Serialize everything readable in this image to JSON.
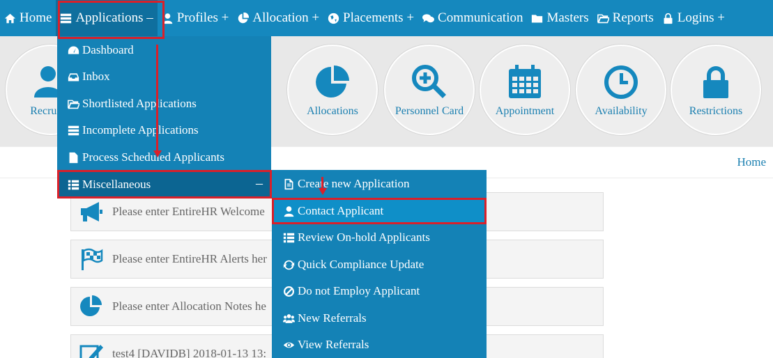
{
  "nav": {
    "items": [
      {
        "label": "Home",
        "icon": "home-icon"
      },
      {
        "label": "Applications –",
        "icon": "list-icon"
      },
      {
        "label": "Profiles +",
        "icon": "user-icon"
      },
      {
        "label": "Allocation +",
        "icon": "pie-chart-icon"
      },
      {
        "label": "Placements +",
        "icon": "globe-icon"
      },
      {
        "label": "Communication",
        "icon": "chat-icon"
      },
      {
        "label": "Masters",
        "icon": "folder-icon"
      },
      {
        "label": "Reports",
        "icon": "folder-open-icon"
      },
      {
        "label": "Logins +",
        "icon": "lock-icon"
      }
    ]
  },
  "tiles": [
    {
      "label": "Recruitm",
      "icon": "user-add-icon"
    },
    {
      "label": "Allocations",
      "icon": "pie-chart-icon"
    },
    {
      "label": "Personnel Card",
      "icon": "search-plus-icon"
    },
    {
      "label": "Appointment",
      "icon": "calendar-icon"
    },
    {
      "label": "Availability",
      "icon": "clock-icon"
    },
    {
      "label": "Restrictions",
      "icon": "lock-icon"
    }
  ],
  "breadcrumb": {
    "home": "Home"
  },
  "notices": [
    {
      "text": "Please enter EntireHR Welcome",
      "icon": "megaphone-icon"
    },
    {
      "text": "Please enter EntireHR Alerts her",
      "icon": "flag-icon"
    },
    {
      "text": "Please enter Allocation Notes he",
      "icon": "pie-chart-icon"
    },
    {
      "text": "test4 [DAVIDB] 2018-01-13 13:",
      "icon": "edit-icon"
    }
  ],
  "applications_menu": {
    "items": [
      {
        "label": "Dashboard",
        "icon": "dashboard-icon"
      },
      {
        "label": "Inbox",
        "icon": "inbox-icon"
      },
      {
        "label": "Shortlisted Applications",
        "icon": "folder-open-icon"
      },
      {
        "label": "Incomplete Applications",
        "icon": "list-icon"
      },
      {
        "label": "Process Scheduled Applicants",
        "icon": "file-icon"
      }
    ],
    "misc_label": "Miscellaneous",
    "misc_toggle": "–"
  },
  "misc_submenu": {
    "items": [
      {
        "label": "Create new Application",
        "icon": "document-icon"
      },
      {
        "label": "Contact Applicant",
        "icon": "user-icon"
      },
      {
        "label": "Review On-hold Applicants",
        "icon": "list-icon"
      },
      {
        "label": "Quick Compliance Update",
        "icon": "refresh-icon"
      },
      {
        "label": "Do not Employ Applicant",
        "icon": "ban-icon"
      },
      {
        "label": "New Referrals",
        "icon": "users-icon"
      },
      {
        "label": "View Referrals",
        "icon": "eye-icon"
      }
    ]
  },
  "colors": {
    "nav_bg": "#1588be",
    "annotation": "#d9202a"
  }
}
